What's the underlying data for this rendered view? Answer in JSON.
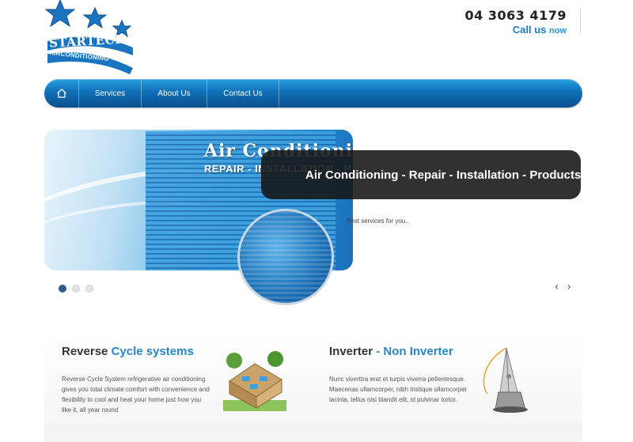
{
  "brand": {
    "logo_text_1": "STARTECH",
    "logo_text_2": "AIRCONDITIONING",
    "logo_color": "#1a74c0"
  },
  "contact": {
    "phone": "04 3063 4179",
    "cta_main": "Call us",
    "cta_suffix": "now"
  },
  "nav": {
    "items": [
      {
        "label": "Services"
      },
      {
        "label": "About Us"
      },
      {
        "label": "Contact Us"
      }
    ],
    "home_icon": "home-icon",
    "color": "#0f6fb6"
  },
  "slider": {
    "image_title": "Air Conditioning",
    "image_subtitle": "REPAIR - INSTALLATION - P",
    "caption": "Air Conditioning - Repair - Installation - Products",
    "subcaption": "Best services for you..",
    "active_slide": 1,
    "total_slides": 3,
    "prev_icon": "chevron-left-icon",
    "next_icon": "chevron-right-icon"
  },
  "features": [
    {
      "title_main": "Reverse",
      "title_accent": "Cycle systems",
      "body": "Reverse Cycle System refrigerative air conditioning gives you total climate comfort with convenience and flexibility to cool and heat your home just how you like it, all year round",
      "image": "house-icon"
    },
    {
      "title_main": "Inverter",
      "title_accent": "- Non Inverter",
      "body": "Nunc viverttra erat et turpis viverra pellentesque. Maecenas ullamcorper, nibh tristique ullamcorper lacinia, tellus nisi blandit elit, id pulvinar tortor.",
      "image": "pen-nib-icon"
    }
  ],
  "colors": {
    "accent": "#2a86c6",
    "dark": "#333333"
  }
}
